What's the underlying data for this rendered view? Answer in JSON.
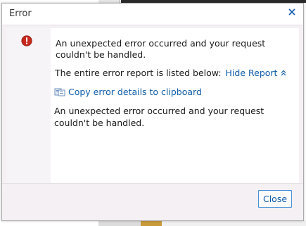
{
  "dialog": {
    "title": "Error",
    "close_icon": "close-icon",
    "message": "An unexpected error occurred and your request couldn't be handled.",
    "report_text": "The entire error report is listed below:",
    "hide_report_label": "Hide Report",
    "copy_label": "Copy error details to clipboard",
    "details": "An unexpected error occurred and your request couldn't be handled.",
    "close_button_label": "Close"
  },
  "colors": {
    "link": "#0f5ca8",
    "error_icon": "#c8291f",
    "button_border": "#4a90d9"
  }
}
